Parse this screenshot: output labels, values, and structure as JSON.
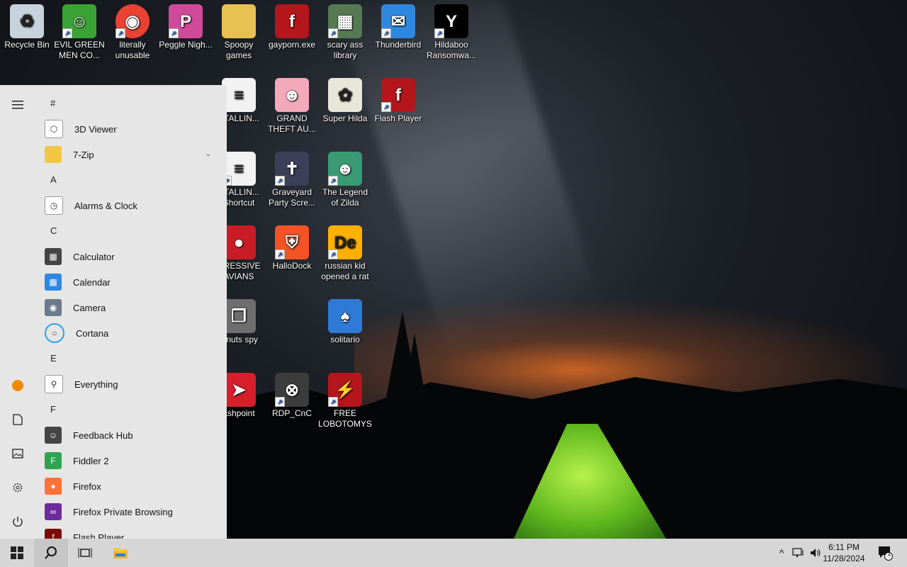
{
  "desktop": {
    "icons": [
      {
        "label": "Recycle Bin",
        "icon": "recycle-bin-icon"
      },
      {
        "label": "EVIL GREEN MEN CO...",
        "icon": "messenger-men-icon"
      },
      {
        "label": "literally unusable",
        "icon": "chrome-icon"
      },
      {
        "label": "Peggle Nigh...",
        "icon": "peggle-icon"
      },
      {
        "label": "Spoopy games",
        "icon": "folder-icon"
      },
      {
        "label": "gayporn.exe",
        "icon": "flash-icon"
      },
      {
        "label": "scary ass library",
        "icon": "library-icon"
      },
      {
        "label": "Thunderbird",
        "icon": "thunderbird-icon"
      },
      {
        "label": "Hildaboo Ransomwa...",
        "icon": "ransomware-icon"
      },
      {
        "label": "STALLIN...",
        "icon": "text-file-icon"
      },
      {
        "label": "GRAND THEFT AU...",
        "icon": "anime-girl-icon"
      },
      {
        "label": "Super Hilda",
        "icon": "pixel-cat-icon"
      },
      {
        "label": "Flash Player",
        "icon": "flash-icon"
      },
      {
        "label": "STALLIN... Shortcut",
        "icon": "text-file-icon"
      },
      {
        "label": "Graveyard Party Scre...",
        "icon": "graveyard-icon"
      },
      {
        "label": "The Legend of Zilda",
        "icon": "pixel-hero-icon"
      },
      {
        "label": "GRESSIVE AVIANS",
        "icon": "angry-bird-icon"
      },
      {
        "label": "HalloDock",
        "icon": "shield-icon"
      },
      {
        "label": "russian kid opened a rat",
        "icon": "de-icon"
      },
      {
        "label": "z nuts spy",
        "icon": "windows-stack-icon"
      },
      {
        "label": "solitario",
        "icon": "solitario-icon"
      },
      {
        "label": "ashpoint",
        "icon": "flashpoint-icon"
      },
      {
        "label": "RDP_CnC",
        "icon": "rdp-icon"
      },
      {
        "label": "FREE LOBOTOMYS",
        "icon": "lobotomy-icon"
      }
    ]
  },
  "start_menu": {
    "rail": [
      "hamburger-menu-icon",
      "user-avatar-icon",
      "documents-icon",
      "pictures-icon",
      "settings-icon",
      "power-icon"
    ],
    "sections": [
      {
        "letter": "#",
        "apps": [
          {
            "label": "3D Viewer",
            "icon": "cube-icon"
          },
          {
            "label": "7-Zip",
            "icon": "folder-icon",
            "expandable": true
          }
        ]
      },
      {
        "letter": "A",
        "apps": [
          {
            "label": "Alarms & Clock",
            "icon": "clock-icon"
          }
        ]
      },
      {
        "letter": "C",
        "apps": [
          {
            "label": "Calculator",
            "icon": "calculator-icon"
          },
          {
            "label": "Calendar",
            "icon": "calendar-icon"
          },
          {
            "label": "Camera",
            "icon": "camera-icon"
          },
          {
            "label": "Cortana",
            "icon": "cortana-icon"
          }
        ]
      },
      {
        "letter": "E",
        "apps": [
          {
            "label": "Everything",
            "icon": "everything-search-icon"
          }
        ]
      },
      {
        "letter": "F",
        "apps": [
          {
            "label": "Feedback Hub",
            "icon": "feedback-icon"
          },
          {
            "label": "Fiddler 2",
            "icon": "fiddler-icon"
          },
          {
            "label": "Firefox",
            "icon": "firefox-icon"
          },
          {
            "label": "Firefox Private Browsing",
            "icon": "firefox-private-icon"
          },
          {
            "label": "Flash Player",
            "icon": "flash-icon"
          }
        ]
      }
    ]
  },
  "taskbar": {
    "time": "6:11 PM",
    "date": "11/28/2024",
    "notification_count": "1"
  }
}
